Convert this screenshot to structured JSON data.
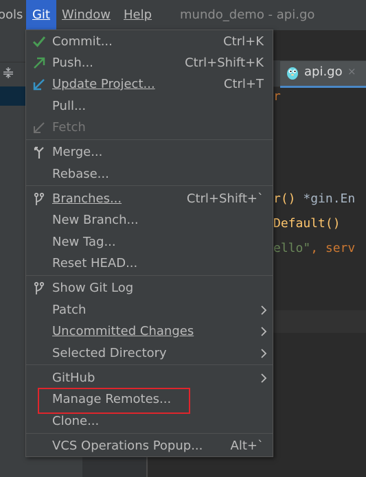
{
  "menubar": {
    "tools_label": "ools",
    "git_label": "Git",
    "window_label": "Window",
    "help_label": "Help",
    "window_title": "mundo_demo - api.go"
  },
  "editor": {
    "tab_label": "api.go",
    "tab_close": "×",
    "code_line_1": "r",
    "code_line_2a": "r() ",
    "code_line_2b": "*gin.En",
    "code_line_3": "Default()",
    "code_line_4a": "ello\"",
    "code_line_4b": ", serv"
  },
  "git_menu": {
    "items": [
      {
        "label": "Commit...",
        "shortcut": "Ctrl+K",
        "icon": "check-icon"
      },
      {
        "label": "Push...",
        "shortcut": "Ctrl+Shift+K",
        "icon": "push-arrow-icon"
      },
      {
        "label": "Update Project...",
        "shortcut": "Ctrl+T",
        "icon": "update-arrow-icon"
      },
      {
        "label": "Pull...",
        "shortcut": ""
      },
      {
        "label": "Fetch",
        "shortcut": "",
        "icon": "fetch-arrow-icon",
        "disabled": true
      },
      {
        "label": "Merge...",
        "shortcut": "",
        "icon": "merge-icon"
      },
      {
        "label": "Rebase...",
        "shortcut": ""
      },
      {
        "label": "Branches...",
        "shortcut": "Ctrl+Shift+`",
        "icon": "branch-icon"
      },
      {
        "label": "New Branch...",
        "shortcut": ""
      },
      {
        "label": "New Tag...",
        "shortcut": ""
      },
      {
        "label": "Reset HEAD...",
        "shortcut": ""
      },
      {
        "label": "Show Git Log",
        "shortcut": "",
        "icon": "branch-icon"
      },
      {
        "label": "Patch",
        "shortcut": "",
        "submenu": true
      },
      {
        "label": "Uncommitted Changes",
        "shortcut": "",
        "submenu": true
      },
      {
        "label": "Selected Directory",
        "shortcut": "",
        "submenu": true
      },
      {
        "label": "GitHub",
        "shortcut": "",
        "submenu": true
      },
      {
        "label": "Manage Remotes...",
        "shortcut": ""
      },
      {
        "label": "Clone...",
        "shortcut": ""
      },
      {
        "label": "VCS Operations Popup...",
        "shortcut": "Alt+`"
      }
    ]
  },
  "colors": {
    "menu_bg": "#3c3f41",
    "git_selected": "#2f65ca",
    "check_green": "#499c54",
    "update_blue": "#3592c4",
    "highlight_red": "#e0252c"
  }
}
